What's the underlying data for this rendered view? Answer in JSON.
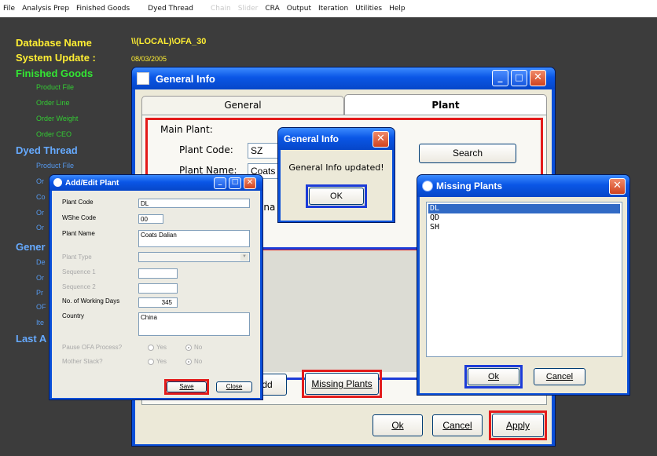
{
  "menu": [
    "File",
    "Analysis Prep",
    "Finished Goods",
    "Dyed Thread",
    "Chain",
    "Slider",
    "CRA",
    "Output",
    "Iteration",
    "Utilities",
    "Help"
  ],
  "menu_disabled": [
    "Chain",
    "Slider"
  ],
  "background": {
    "db_label": "Database Name",
    "db_value": "\\\\(LOCAL)\\OFA_30",
    "sys_label": "System Update :",
    "sys_value": "08/03/2005",
    "finished_goods": "Finished Goods",
    "fg_items": [
      "Product File",
      "Order Line",
      "Order Weight",
      "Order CEO"
    ],
    "dyed_thread": "Dyed Thread",
    "dt_items": [
      "Product File",
      "Or",
      "Co",
      "Or",
      "Or"
    ],
    "general": "Gener",
    "gen_items": [
      "De",
      "Or",
      "Pr",
      "OF",
      "Ite"
    ],
    "last": "Last A"
  },
  "general_info": {
    "title": "General Info",
    "tab_general": "General",
    "tab_plant": "Plant",
    "main_plant": "Main Plant:",
    "plant_code_label": "Plant Code:",
    "plant_code_value": "SZ",
    "plant_name_label": "Plant Name:",
    "plant_name_value": "Coats",
    "country_partial": "ina",
    "search": "Search",
    "add_partial": "dd",
    "missing_plants": "Missing Plants",
    "ok": "Ok",
    "cancel": "Cancel",
    "apply": "Apply"
  },
  "msgbox": {
    "title": "General Info",
    "text": "General Info updated!",
    "ok": "OK"
  },
  "missing_plants": {
    "title": "Missing Plants",
    "items": [
      "DL",
      "QD",
      "SH"
    ],
    "ok": "Ok",
    "cancel": "Cancel"
  },
  "add_edit": {
    "title": "Add/Edit Plant",
    "plant_code_label": "Plant Code",
    "plant_code": "DL",
    "wshe_label": "WShe Code",
    "wshe": "00",
    "plant_name_label": "Plant Name",
    "plant_name": "Coats Dalian",
    "plant_type_label": "Plant Type",
    "seq1_label": "Sequence 1",
    "seq2_label": "Sequence 2",
    "working_days_label": "No. of Working Days",
    "working_days": "345",
    "country_label": "Country",
    "country": "China",
    "pause_label": "Pause OFA Process?",
    "mother_label": "Mother Stack?",
    "yes": "Yes",
    "no": "No",
    "save": "Save",
    "close": "Close"
  }
}
